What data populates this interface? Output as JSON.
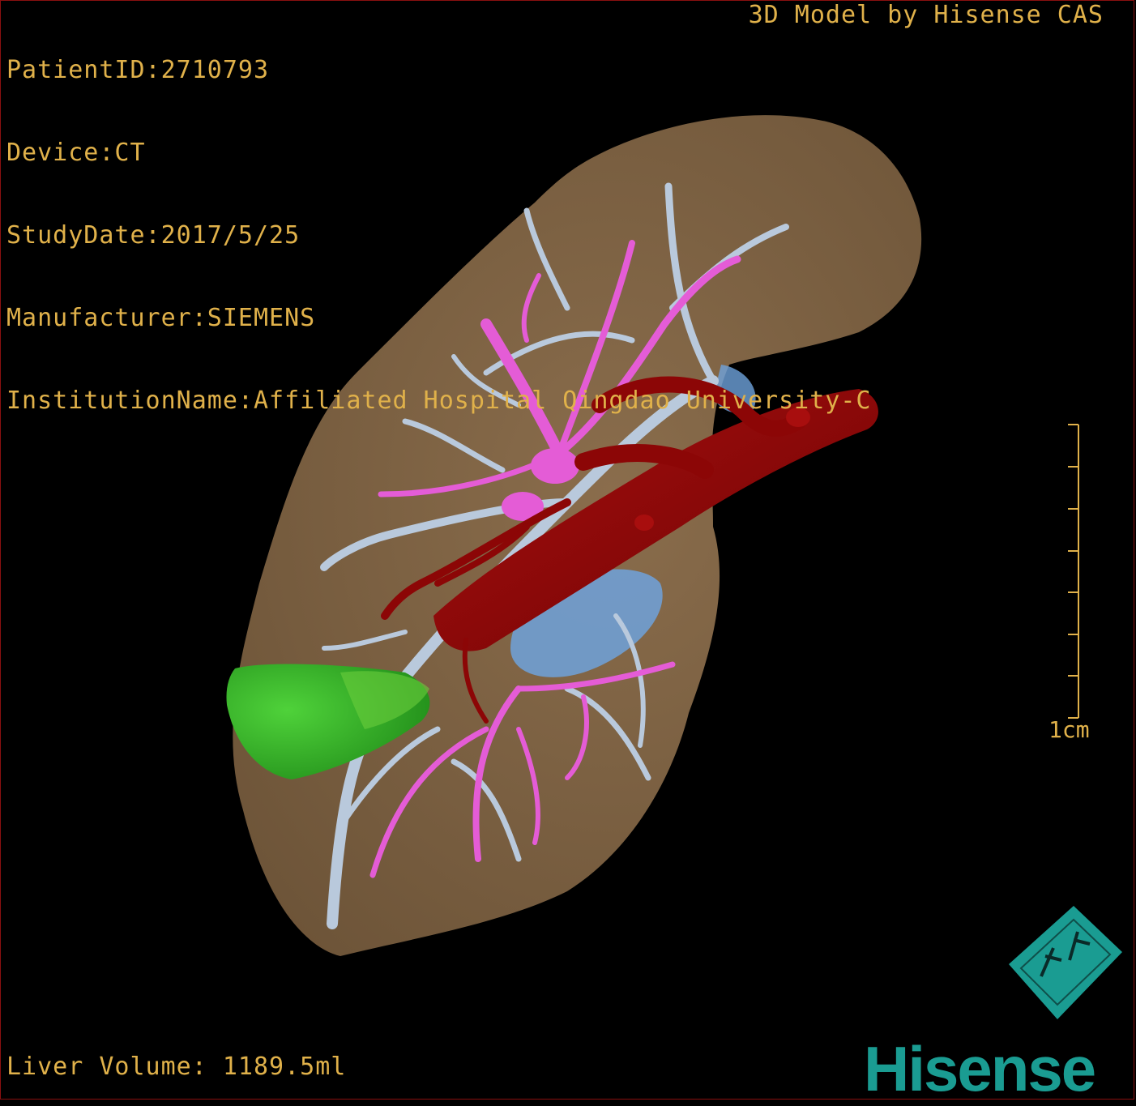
{
  "overlay": {
    "patient_id": "PatientID:2710793",
    "device": "Device:CT",
    "study_date": "StudyDate:2017/5/25",
    "manufacturer": "Manufacturer:SIEMENS",
    "institution": "InstitutionName:Affiliated Hospital Qingdao University-C",
    "model_credit": "3D Model by Hisense CAS",
    "liver_volume": "Liver Volume: 1189.5ml",
    "scale_label": "1cm",
    "logo_text": "Hisense"
  },
  "colors": {
    "text": "#e0b14a",
    "liver": "#7d6244",
    "portal_vein": "#b9c9dc",
    "hepatic_vein": "#e45cd6",
    "artery": "#8c0606",
    "gallbladder": "#3fb52f",
    "lesion": "#6ea2dc",
    "logo": "#1a9c92"
  },
  "icons": [
    "orientation-cube-icon",
    "hisense-logo"
  ]
}
